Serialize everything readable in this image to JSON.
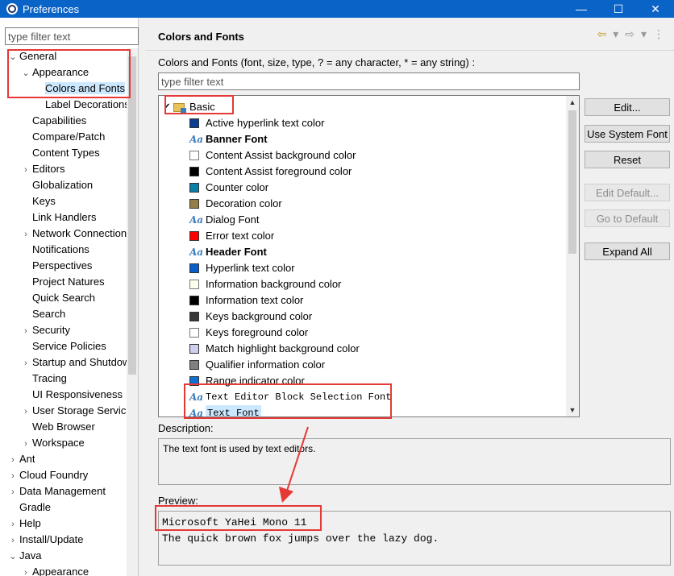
{
  "window": {
    "title": "Preferences",
    "minimize": "—",
    "maximize": "☐",
    "close": "✕"
  },
  "left": {
    "filter_placeholder": "type filter text",
    "tree": [
      {
        "label": "General",
        "indent": 0,
        "twisty": "open"
      },
      {
        "label": "Appearance",
        "indent": 1,
        "twisty": "open"
      },
      {
        "label": "Colors and Fonts",
        "indent": 2,
        "twisty": "none",
        "selected": true
      },
      {
        "label": "Label Decorations",
        "indent": 2,
        "twisty": "none"
      },
      {
        "label": "Capabilities",
        "indent": 1,
        "twisty": "none"
      },
      {
        "label": "Compare/Patch",
        "indent": 1,
        "twisty": "none"
      },
      {
        "label": "Content Types",
        "indent": 1,
        "twisty": "none"
      },
      {
        "label": "Editors",
        "indent": 1,
        "twisty": "closed"
      },
      {
        "label": "Globalization",
        "indent": 1,
        "twisty": "none"
      },
      {
        "label": "Keys",
        "indent": 1,
        "twisty": "none"
      },
      {
        "label": "Link Handlers",
        "indent": 1,
        "twisty": "none"
      },
      {
        "label": "Network Connections",
        "indent": 1,
        "twisty": "closed"
      },
      {
        "label": "Notifications",
        "indent": 1,
        "twisty": "none"
      },
      {
        "label": "Perspectives",
        "indent": 1,
        "twisty": "none"
      },
      {
        "label": "Project Natures",
        "indent": 1,
        "twisty": "none"
      },
      {
        "label": "Quick Search",
        "indent": 1,
        "twisty": "none"
      },
      {
        "label": "Search",
        "indent": 1,
        "twisty": "none"
      },
      {
        "label": "Security",
        "indent": 1,
        "twisty": "closed"
      },
      {
        "label": "Service Policies",
        "indent": 1,
        "twisty": "none"
      },
      {
        "label": "Startup and Shutdown",
        "indent": 1,
        "twisty": "closed"
      },
      {
        "label": "Tracing",
        "indent": 1,
        "twisty": "none"
      },
      {
        "label": "UI Responsiveness",
        "indent": 1,
        "twisty": "none"
      },
      {
        "label": "User Storage Service",
        "indent": 1,
        "twisty": "closed"
      },
      {
        "label": "Web Browser",
        "indent": 1,
        "twisty": "none"
      },
      {
        "label": "Workspace",
        "indent": 1,
        "twisty": "closed"
      },
      {
        "label": "Ant",
        "indent": 0,
        "twisty": "closed"
      },
      {
        "label": "Cloud Foundry",
        "indent": 0,
        "twisty": "closed"
      },
      {
        "label": "Data Management",
        "indent": 0,
        "twisty": "closed"
      },
      {
        "label": "Gradle",
        "indent": 0,
        "twisty": "none"
      },
      {
        "label": "Help",
        "indent": 0,
        "twisty": "closed"
      },
      {
        "label": "Install/Update",
        "indent": 0,
        "twisty": "closed"
      },
      {
        "label": "Java",
        "indent": 0,
        "twisty": "open"
      },
      {
        "label": "Appearance",
        "indent": 1,
        "twisty": "closed"
      }
    ]
  },
  "page": {
    "title": "Colors and Fonts",
    "caption": "Colors and Fonts (font, size, type, ? = any character, * = any string) :",
    "filter_placeholder": "type filter text",
    "nav": {
      "back": "⇦",
      "back_menu": "▾",
      "forward": "⇨",
      "forward_menu": "▾",
      "more": "⋮"
    },
    "category": "Basic",
    "items": [
      {
        "label": "Active hyperlink text color",
        "kind": "color",
        "color": "#0b3d91"
      },
      {
        "label": "Banner Font",
        "kind": "font",
        "style": "bold"
      },
      {
        "label": "Content Assist background color",
        "kind": "color",
        "color": "#ffffff"
      },
      {
        "label": "Content Assist foreground color",
        "kind": "color",
        "color": "#000000"
      },
      {
        "label": "Counter color",
        "kind": "color",
        "color": "#0c7fa8"
      },
      {
        "label": "Decoration color",
        "kind": "color",
        "color": "#957d47"
      },
      {
        "label": "Dialog Font",
        "kind": "font",
        "style": "normal"
      },
      {
        "label": "Error text color",
        "kind": "color",
        "color": "#ff0000"
      },
      {
        "label": "Header Font",
        "kind": "font",
        "style": "bold"
      },
      {
        "label": "Hyperlink text color",
        "kind": "color",
        "color": "#0a5cc7"
      },
      {
        "label": "Information background color",
        "kind": "color",
        "color": "#fffff0"
      },
      {
        "label": "Information text color",
        "kind": "color",
        "color": "#000000"
      },
      {
        "label": "Keys background color",
        "kind": "color",
        "color": "#383838"
      },
      {
        "label": "Keys foreground color",
        "kind": "color",
        "color": "#ffffff"
      },
      {
        "label": "Match highlight background color",
        "kind": "color",
        "color": "#cfd0f0"
      },
      {
        "label": "Qualifier information color",
        "kind": "color",
        "color": "#808080"
      },
      {
        "label": "Range indicator color",
        "kind": "color",
        "color": "#1070d0"
      },
      {
        "label": "Text Editor Block Selection Font",
        "kind": "font",
        "style": "mono"
      },
      {
        "label": "Text Font",
        "kind": "font",
        "style": "mono",
        "selected": true
      }
    ],
    "buttons": {
      "edit": "Edit...",
      "use_system_font": "Use System Font",
      "reset": "Reset",
      "edit_default": "Edit Default...",
      "go_to_default": "Go to Default",
      "expand_all": "Expand All"
    },
    "description_label": "Description:",
    "description": "The text font is used by text editors.",
    "preview_label": "Preview:",
    "preview_font": "Microsoft YaHei Mono 11",
    "preview_sample": "The quick brown fox jumps over the lazy dog."
  },
  "colors": {
    "annotation": "#e53935",
    "selection": "#cce8ff",
    "titlebar": "#0a64c8"
  }
}
